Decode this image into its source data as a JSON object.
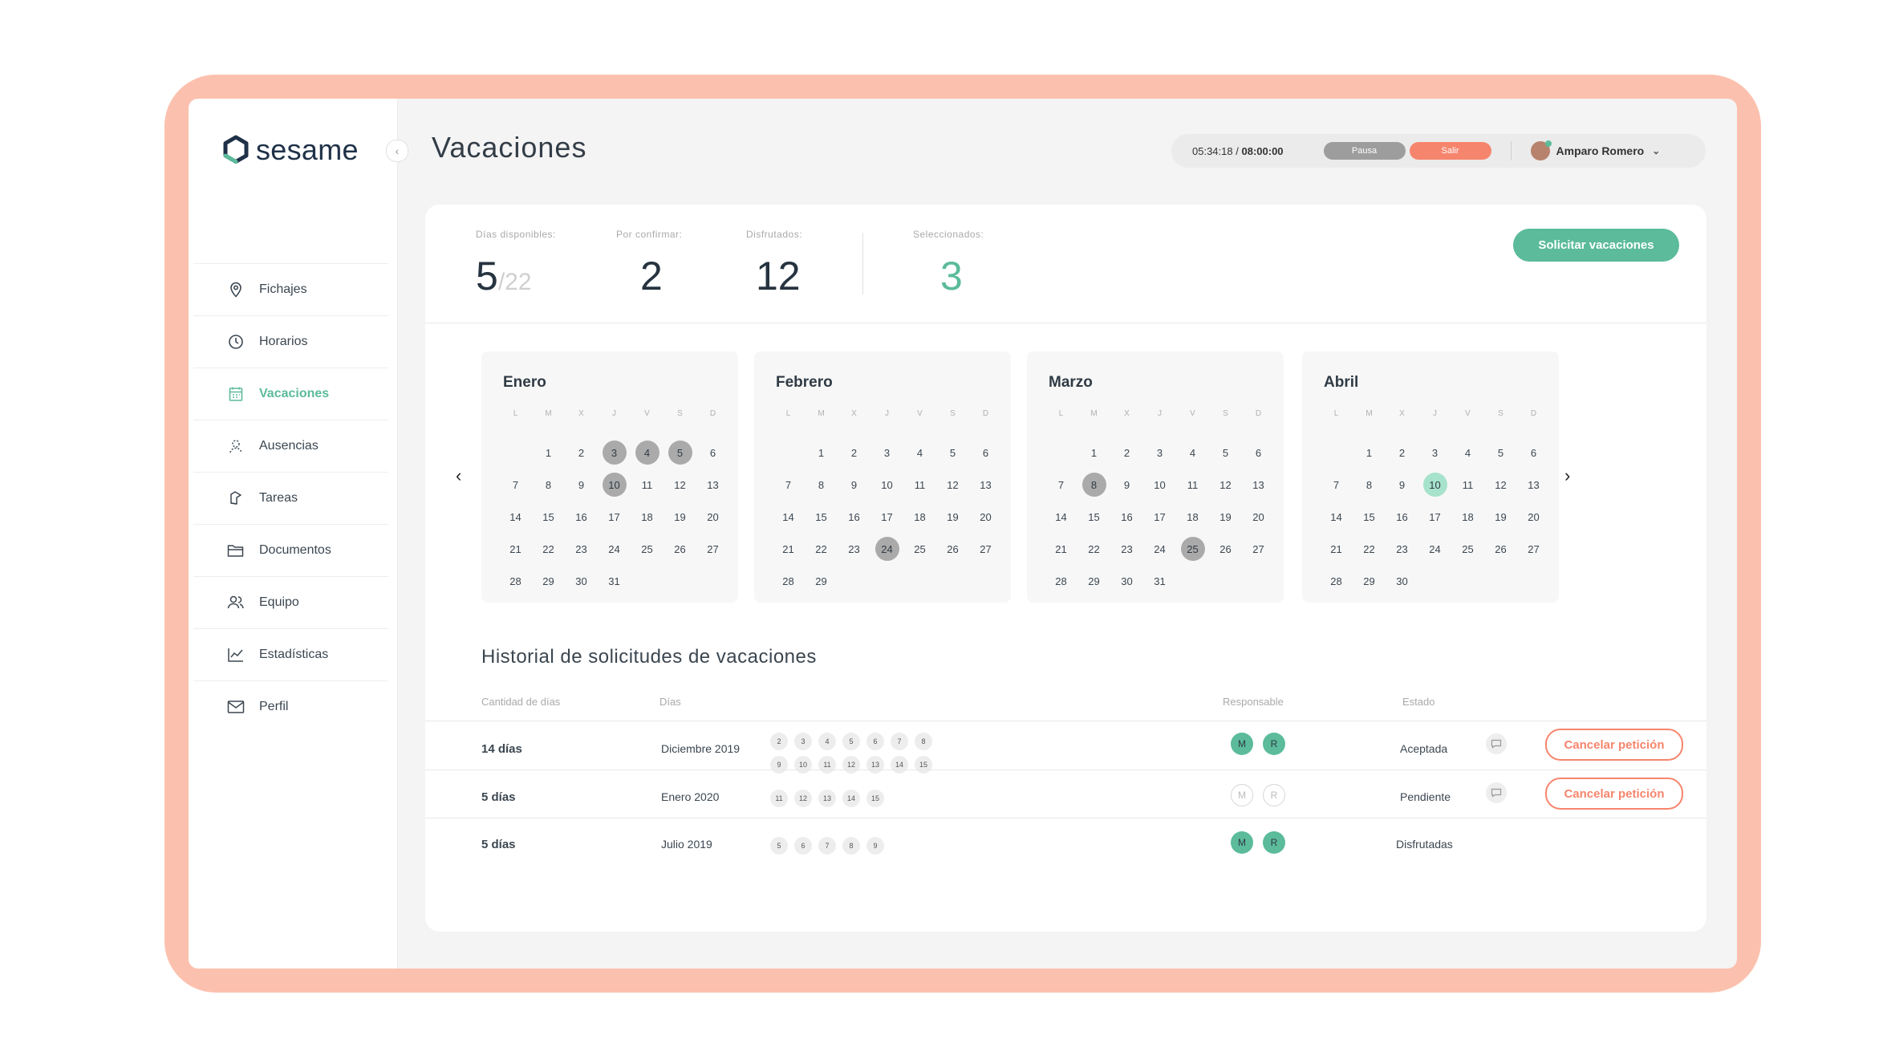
{
  "brand": {
    "name": "sesame"
  },
  "sidebar": {
    "items": [
      {
        "label": "Fichajes",
        "icon": "location-pin-icon"
      },
      {
        "label": "Horarios",
        "icon": "clock-icon"
      },
      {
        "label": "Vacaciones",
        "icon": "calendar-icon",
        "active": true
      },
      {
        "label": "Ausencias",
        "icon": "absence-icon"
      },
      {
        "label": "Tareas",
        "icon": "tasks-icon"
      },
      {
        "label": "Documentos",
        "icon": "folder-icon"
      },
      {
        "label": "Equipo",
        "icon": "team-icon"
      },
      {
        "label": "Estadísticas",
        "icon": "chart-icon"
      },
      {
        "label": "Perfil",
        "icon": "envelope-icon"
      }
    ]
  },
  "header": {
    "title": "Vacaciones",
    "timer": {
      "elapsed": "05:34:18",
      "separator": "/",
      "total": "08:00:00"
    },
    "pause_label": "Pausa",
    "exit_label": "Salir",
    "user_name": "Amparo Romero"
  },
  "stats": {
    "available": {
      "label": "Días disponibles:",
      "value": "5",
      "total": "/22"
    },
    "pending": {
      "label": "Por confirmar:",
      "value": "2"
    },
    "enjoyed": {
      "label": "Disfrutados:",
      "value": "12"
    },
    "selected": {
      "label": "Seleccionados:",
      "value": "3"
    },
    "request_button": "Solicitar vacaciones"
  },
  "calendar": {
    "weekdays": [
      "L",
      "M",
      "X",
      "J",
      "V",
      "S",
      "D"
    ],
    "months": [
      {
        "name": "Enero",
        "offset": 1,
        "days": 31,
        "selected": [
          3,
          4,
          5,
          10
        ],
        "current": []
      },
      {
        "name": "Febrero",
        "offset": 1,
        "days": 29,
        "selected": [
          24
        ],
        "current": []
      },
      {
        "name": "Marzo",
        "offset": 1,
        "days": 31,
        "selected": [
          8,
          25
        ],
        "current": []
      },
      {
        "name": "Abril",
        "offset": 1,
        "days": 30,
        "selected": [],
        "current": [
          10
        ]
      }
    ]
  },
  "history": {
    "title": "Historial de solicitudes de vacaciones",
    "columns": {
      "amount": "Cantidad de días",
      "days": "Días",
      "responsible": "Responsable",
      "status": "Estado"
    },
    "rows": [
      {
        "amount": "14 días",
        "period": "Diciembre 2019",
        "days": [
          "2",
          "3",
          "4",
          "5",
          "6",
          "7",
          "8",
          "9",
          "10",
          "11",
          "12",
          "13",
          "14",
          "15"
        ],
        "responsible": [
          {
            "initial": "M",
            "approved": true
          },
          {
            "initial": "R",
            "approved": true
          }
        ],
        "status": "Aceptada",
        "comment": true,
        "cancel": "Cancelar petición"
      },
      {
        "amount": "5 días",
        "period": "Enero 2020",
        "days": [
          "11",
          "12",
          "13",
          "14",
          "15"
        ],
        "responsible": [
          {
            "initial": "M",
            "approved": false
          },
          {
            "initial": "R",
            "approved": false
          }
        ],
        "status": "Pendiente",
        "comment": true,
        "cancel": "Cancelar petición"
      },
      {
        "amount": "5 días",
        "period": "Julio 2019",
        "days": [
          "5",
          "6",
          "7",
          "8",
          "9"
        ],
        "responsible": [
          {
            "initial": "M",
            "approved": true
          },
          {
            "initial": "R",
            "approved": true
          }
        ],
        "status": "Disfrutadas",
        "comment": false,
        "cancel": ""
      }
    ]
  },
  "colors": {
    "accent": "#5bbb9b",
    "danger": "#f6856d",
    "frame": "#fcc1ae"
  }
}
